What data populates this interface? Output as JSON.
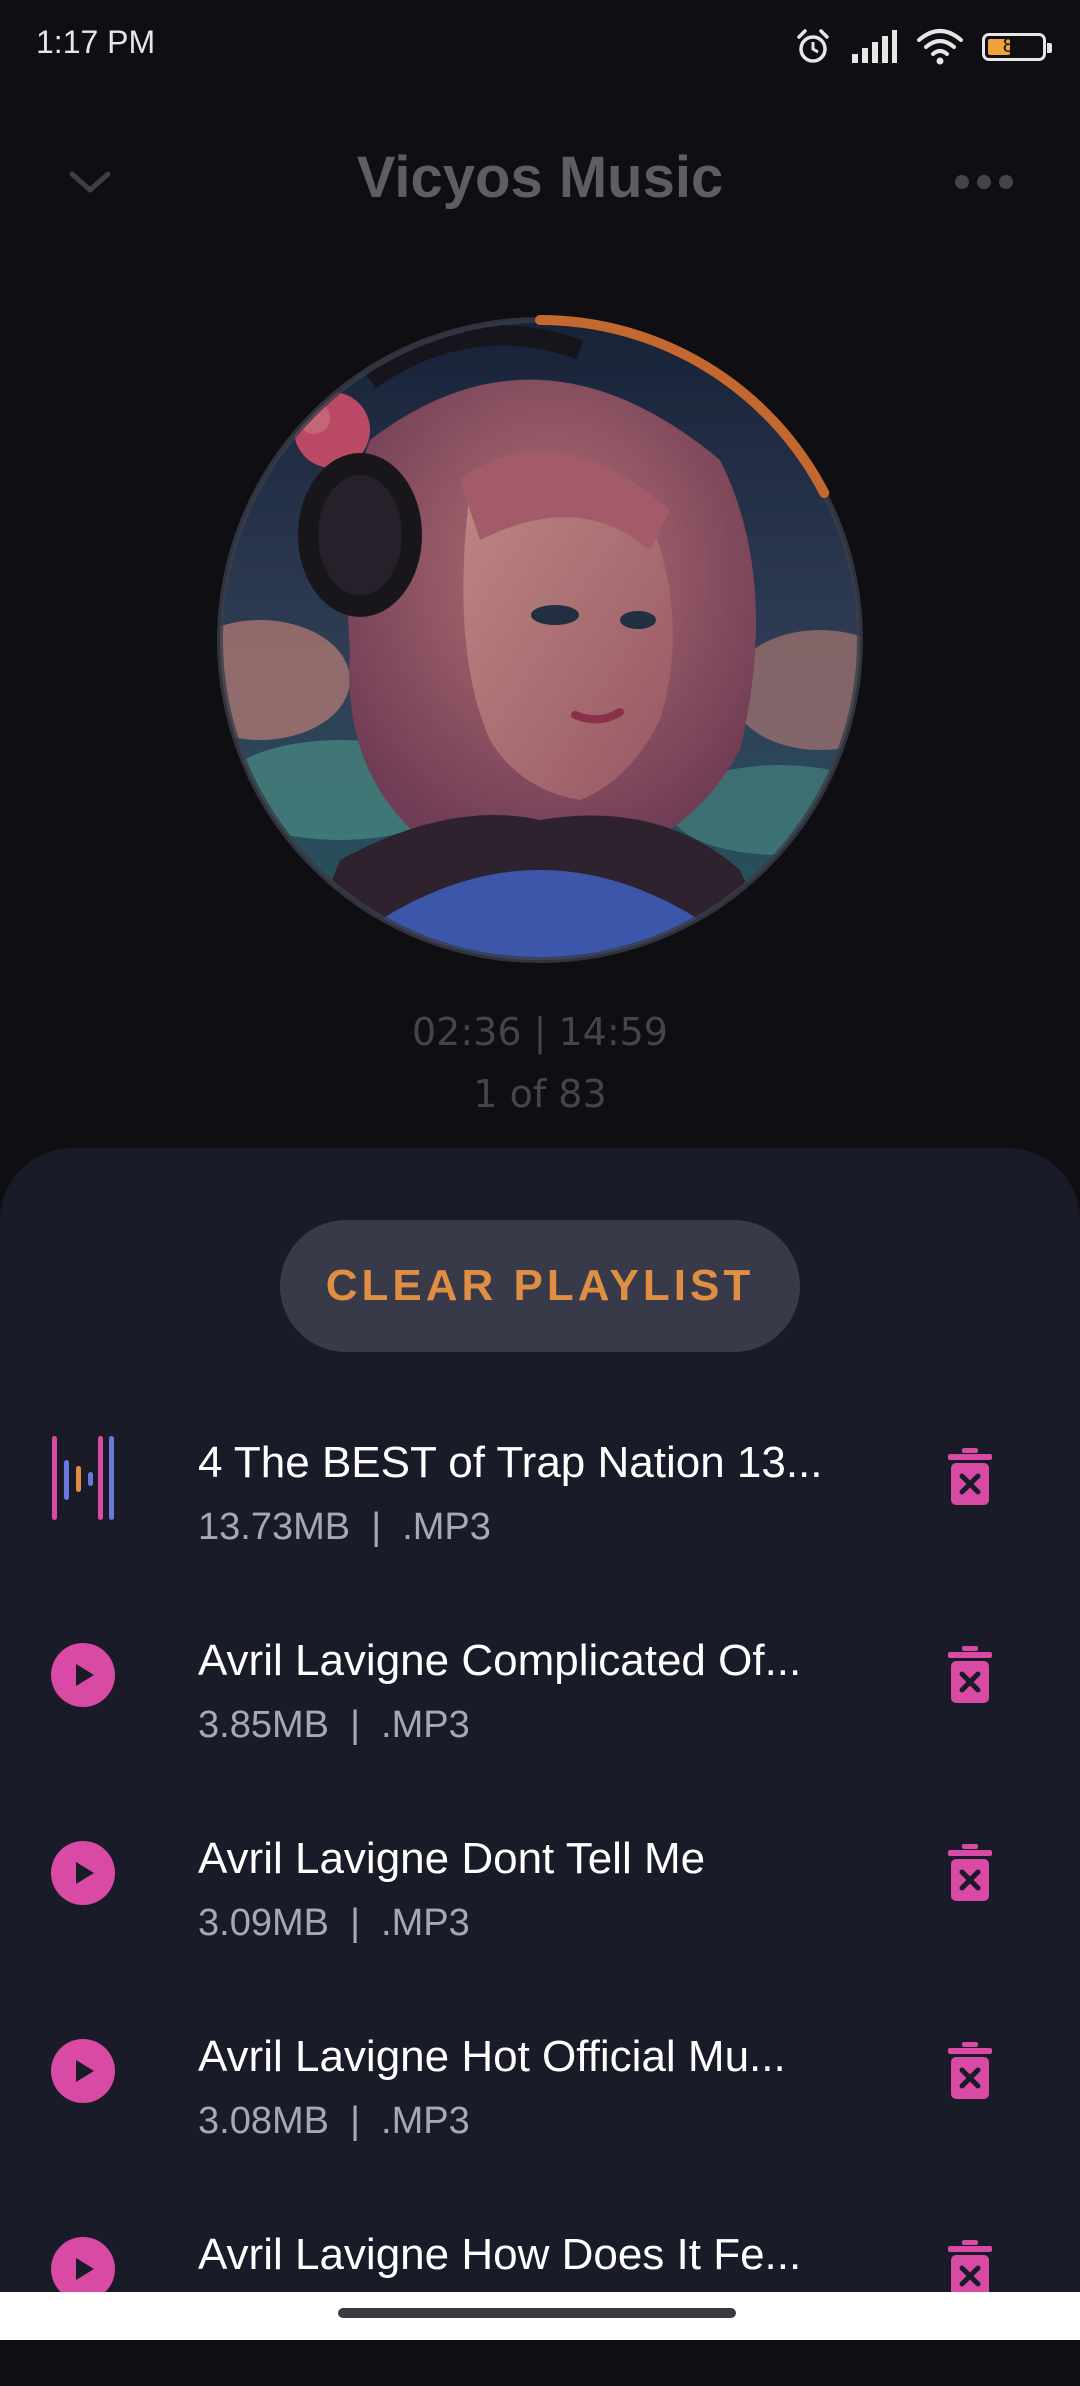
{
  "status_bar": {
    "time": "1:17 PM",
    "battery_level": "80",
    "icons": [
      "alarm-icon",
      "signal-icon",
      "wifi-icon",
      "battery-icon"
    ]
  },
  "header": {
    "title": "Vicyos Music",
    "back_icon": "chevron-down-icon",
    "menu_icon": "more-horizontal-icon"
  },
  "player": {
    "progress_fraction": 0.174,
    "time_readout": "02:36 | 14:59",
    "track_position": "1 of 83"
  },
  "playlist": {
    "clear_label": "CLEAR PLAYLIST",
    "items": [
      {
        "title": "4 The BEST of Trap Nation 13...",
        "meta": "13.73MB  |  .MP3",
        "lead_icon": "equalizer-icon",
        "playing": true
      },
      {
        "title": "Avril Lavigne  Complicated Of...",
        "meta": "3.85MB  |  .MP3",
        "lead_icon": "play-icon",
        "playing": false
      },
      {
        "title": "Avril Lavigne  Dont Tell Me",
        "meta": "3.09MB  |  .MP3",
        "lead_icon": "play-icon",
        "playing": false
      },
      {
        "title": "Avril Lavigne  Hot Official Mu...",
        "meta": "3.08MB  |  .MP3",
        "lead_icon": "play-icon",
        "playing": false
      },
      {
        "title": "Avril Lavigne  How Does It Fe...",
        "meta": "",
        "lead_icon": "play-icon",
        "playing": false
      }
    ]
  },
  "colors": {
    "background": "#0e0e13",
    "sheet": "#1a1b29",
    "accent_pink": "#d84aa4",
    "accent_orange": "#e18e45",
    "button_bg": "#383a49"
  }
}
